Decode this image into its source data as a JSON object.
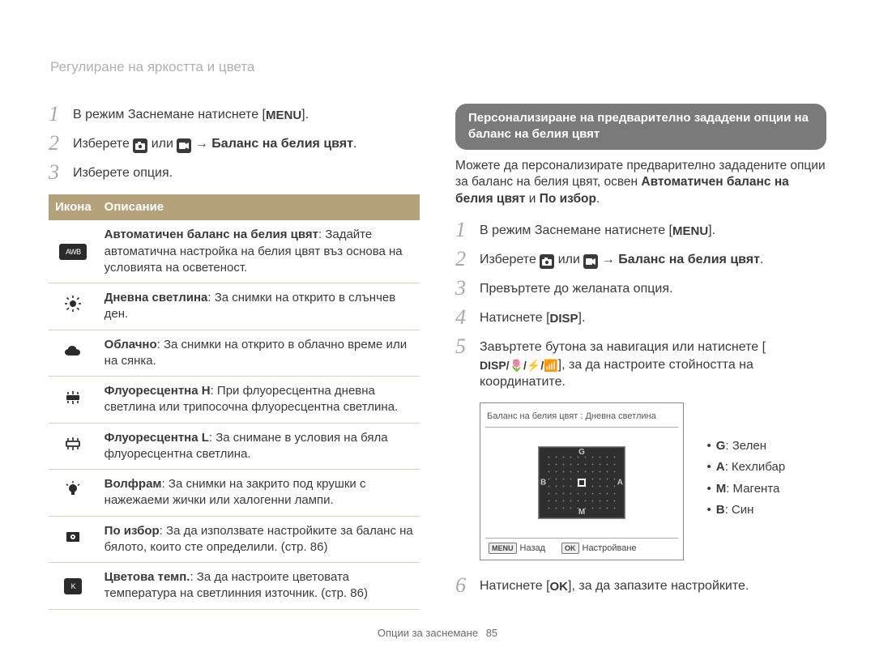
{
  "breadcrumb": "Регулиране на яркостта и цвета",
  "left": {
    "steps": [
      {
        "n": "1",
        "pre": "В режим Заснемане натиснете [",
        "key": "MENU",
        "post": "]."
      },
      {
        "n": "2",
        "pre": "Изберете ",
        "icon1": "camera",
        "mid": " или ",
        "icon2": "video",
        "arrow": " → ",
        "bold": "Баланс на белия цвят",
        "post": "."
      },
      {
        "n": "3",
        "text": "Изберете опция."
      }
    ],
    "table": {
      "h1": "Икона",
      "h2": "Описание",
      "rows": [
        {
          "icon": "awb",
          "title": "Автоматичен баланс на белия цвят",
          "body": ": Задайте автоматична настройка на белия цвят въз основа на условията на осветеност."
        },
        {
          "icon": "sun",
          "title": "Дневна светлина",
          "body": ": За снимки на открито в слънчев ден."
        },
        {
          "icon": "cloud",
          "title": "Облачно",
          "body": ": За снимки на открито в облачно време или на сянка."
        },
        {
          "icon": "fluoH",
          "title": "Флуоресцентна H",
          "body": ": При флуоресцентна дневна светлина или трипосочна флуоресцентна светлина."
        },
        {
          "icon": "fluoL",
          "title": "Флуоресцентна L",
          "body": ": За снимане в условия на бяла флуоресцентна светлина."
        },
        {
          "icon": "tungsten",
          "title": "Волфрам",
          "body": ": За снимки на закрито под крушки с нажежаеми жички или халогенни лампи."
        },
        {
          "icon": "custom",
          "title": "По избор",
          "body": ": За да използвате настройките за баланс на бялото, които сте определили. (стр. 86)"
        },
        {
          "icon": "k",
          "title": "Цветова темп.",
          "body": ": За да настроите цветовата температура на светлинния източник. (стр. 86)"
        }
      ]
    }
  },
  "right": {
    "callout": "Персонализиране на предварително зададени опции на баланс на белия цвят",
    "para_pre": "Можете да персонализирате предварително зададените опции за баланс на белия цвят, освен ",
    "para_bold1": "Автоматичен баланс на белия цвят",
    "para_mid": " и ",
    "para_bold2": "По избор",
    "para_post": ".",
    "steps": [
      {
        "n": "1",
        "pre": "В режим Заснемане натиснете [",
        "key": "MENU",
        "post": "]."
      },
      {
        "n": "2",
        "pre": "Изберете ",
        "icon1": "camera",
        "mid": " или ",
        "icon2": "video",
        "arrow": " → ",
        "bold": "Баланс на белия цвят",
        "post": "."
      },
      {
        "n": "3",
        "text": "Превъртете до желаната опция."
      },
      {
        "n": "4",
        "pre": "Натиснете [",
        "key": "DISP",
        "post": "]."
      },
      {
        "n": "5",
        "text_a": "Завъртете бутона за навигация или натиснете [",
        "keys": "DISP/🌷/⚡/📶",
        "text_b": "], за да настроите стойността на координатите."
      }
    ],
    "device": {
      "title": "Баланс на белия цвят : Дневна светлина",
      "g": "G",
      "a": "A",
      "m": "M",
      "b": "B",
      "back_key": "MENU",
      "back": "Назад",
      "ok_key": "OK",
      "ok": "Настройване"
    },
    "legend": [
      {
        "k": "G",
        "v": ": Зелен"
      },
      {
        "k": "A",
        "v": ": Кехлибар"
      },
      {
        "k": "M",
        "v": ": Магента"
      },
      {
        "k": "B",
        "v": ": Син"
      }
    ],
    "step6": {
      "n": "6",
      "pre": "Натиснете [",
      "key": "OK",
      "post": "], за да запазите настройките."
    }
  },
  "footer": {
    "section": "Опции за заснемане",
    "page": "85"
  },
  "icons": {
    "awb_label": "AWB",
    "k_label": "K"
  }
}
